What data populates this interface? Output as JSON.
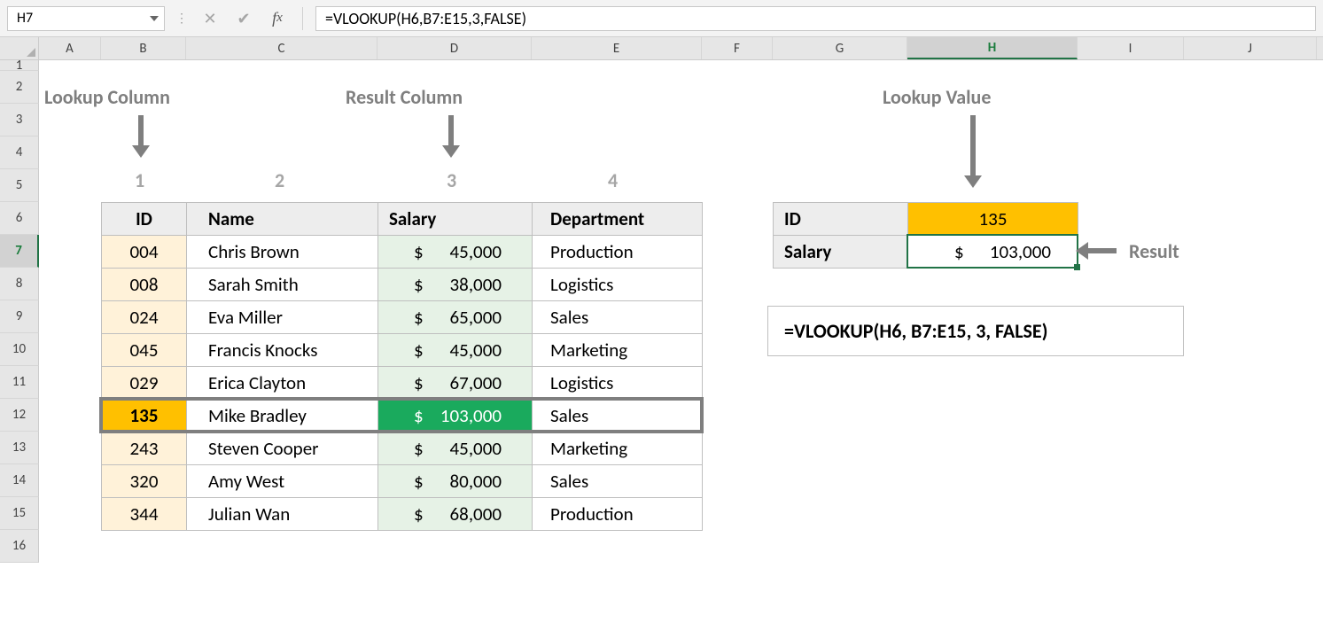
{
  "formula_bar": {
    "cell_ref": "H7",
    "formula": "=VLOOKUP(H6,B7:E15,3,FALSE)"
  },
  "columns": [
    "A",
    "B",
    "C",
    "D",
    "E",
    "F",
    "G",
    "H",
    "I",
    "J"
  ],
  "rows": [
    "1",
    "2",
    "3",
    "4",
    "5",
    "6",
    "7",
    "8",
    "9",
    "10",
    "11",
    "12",
    "13",
    "14",
    "15",
    "16"
  ],
  "active_col": "H",
  "active_row": "7",
  "annotations": {
    "lookup_column": "Lookup Column",
    "result_column": "Result Column",
    "lookup_value": "Lookup Value",
    "result": "Result",
    "col_indices": [
      "1",
      "2",
      "3",
      "4"
    ]
  },
  "table": {
    "headers": {
      "id": "ID",
      "name": "Name",
      "salary": "Salary",
      "dept": "Department"
    },
    "rows": [
      {
        "id": "004",
        "name": "Chris Brown",
        "salary_sym": "$",
        "salary_val": "45,000",
        "dept": "Production"
      },
      {
        "id": "008",
        "name": "Sarah Smith",
        "salary_sym": "$",
        "salary_val": "38,000",
        "dept": "Logistics"
      },
      {
        "id": "024",
        "name": "Eva Miller",
        "salary_sym": "$",
        "salary_val": "65,000",
        "dept": "Sales"
      },
      {
        "id": "045",
        "name": "Francis Knocks",
        "salary_sym": "$",
        "salary_val": "45,000",
        "dept": "Marketing"
      },
      {
        "id": "029",
        "name": "Erica Clayton",
        "salary_sym": "$",
        "salary_val": "67,000",
        "dept": "Logistics"
      },
      {
        "id": "135",
        "name": "Mike Bradley",
        "salary_sym": "$",
        "salary_val": "103,000",
        "dept": "Sales",
        "highlight": true
      },
      {
        "id": "243",
        "name": "Steven Cooper",
        "salary_sym": "$",
        "salary_val": "45,000",
        "dept": "Marketing"
      },
      {
        "id": "320",
        "name": "Amy West",
        "salary_sym": "$",
        "salary_val": "80,000",
        "dept": "Sales"
      },
      {
        "id": "344",
        "name": "Julian Wan",
        "salary_sym": "$",
        "salary_val": "68,000",
        "dept": "Production"
      }
    ]
  },
  "lookup": {
    "id_label": "ID",
    "id_value": "135",
    "salary_label": "Salary",
    "salary_sym": "$",
    "salary_val": "103,000"
  },
  "formula_callout": "=VLOOKUP(H6, B7:E15, 3, FALSE)"
}
